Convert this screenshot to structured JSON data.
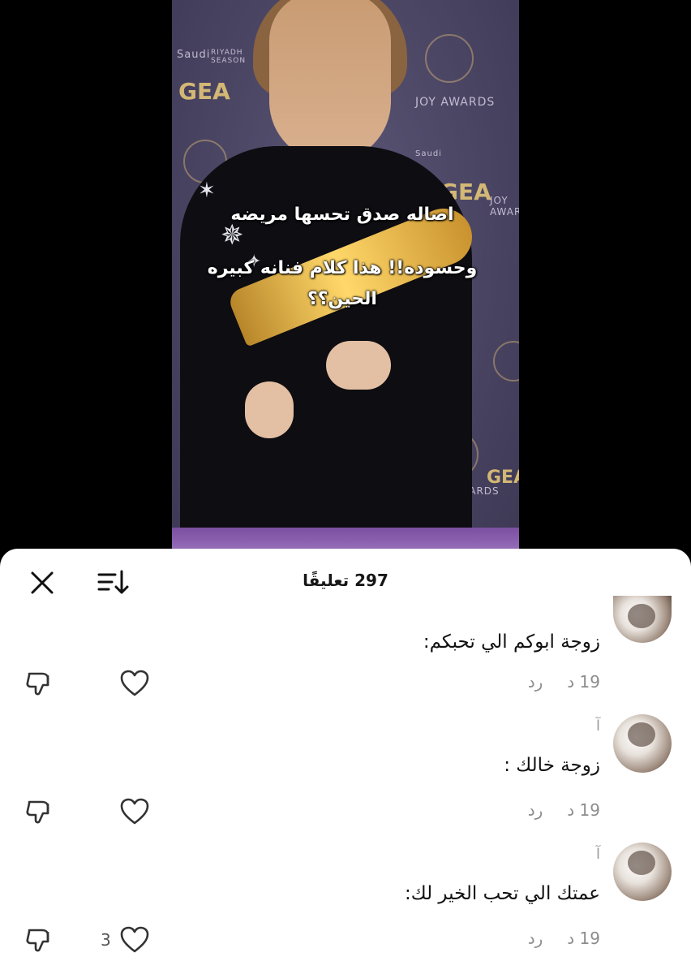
{
  "video": {
    "caption_lines": [
      "اصاله صدق تحسها مريضه",
      "وحسوده!! هذا كلام فنانه كبيره",
      "الحين؟؟"
    ],
    "backdrop": {
      "brand_gea": "GEA",
      "joy_awards": "JOY AWARDS",
      "riyadh_season": "RIYADH SEASON",
      "saudi": "Saudi"
    }
  },
  "sheet": {
    "title": "297 تعليقًا",
    "icons": {
      "close": "close-icon",
      "sort": "sort-icon"
    }
  },
  "comments": [
    {
      "username": "",
      "text": "زوجة ابوكم الي تحبكم:",
      "time": "19 د",
      "reply_label": "رد",
      "likes": ""
    },
    {
      "username": "آ",
      "text": "زوجة خالك :",
      "time": "19 د",
      "reply_label": "رد",
      "likes": ""
    },
    {
      "username": "آ",
      "text": "عمتك الي تحب الخير لك:",
      "time": "19 د",
      "reply_label": "رد",
      "likes": "3"
    }
  ],
  "colors": {
    "sheet_bg": "#ffffff",
    "text_primary": "#111111",
    "text_secondary": "#8c8c8c",
    "floor_purple": "#a27bc4"
  }
}
